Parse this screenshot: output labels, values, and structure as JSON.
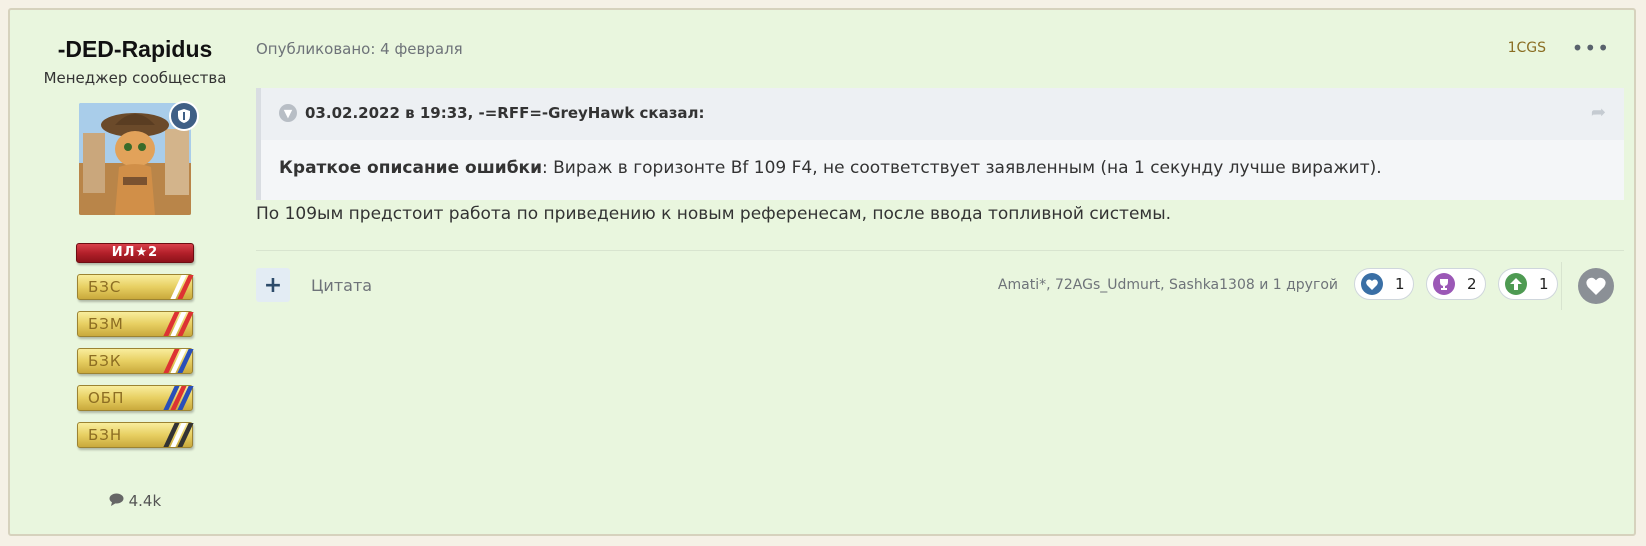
{
  "author": {
    "name": "-DED-Rapidus",
    "title": "Менеджер сообщества",
    "rank_badges": [
      "ИЛ★2",
      "БЗС",
      "БЗМ",
      "БЗК",
      "ОБП",
      "БЗН"
    ],
    "posts_count": "4.4k"
  },
  "post": {
    "published": "Опубликовано: 4 февраля",
    "clan": "1CGS",
    "more": "•••",
    "quote": {
      "header": "03.02.2022 в 19:33, -=RFF=-GreyHawk сказал:",
      "label": "Краткое описание ошибки",
      "text": ": Вираж в горизонте Bf 109 F4, не соответствует заявленным (на 1 секунду лучше виражит)."
    },
    "text": "По 109ым предстоит работа по приведению к новым референесам, после ввода топливной системы."
  },
  "footer": {
    "plus": "+",
    "quote_label": "Цитата",
    "likers": "Amati*, 72AGs_Udmurt, Sashka1308 и 1 другой",
    "reactions": [
      {
        "icon": "heart-icon",
        "count": "1",
        "color": "#3a6fa5"
      },
      {
        "icon": "trophy-icon",
        "count": "2",
        "color": "#9b58b6"
      },
      {
        "icon": "arrow-up-icon",
        "count": "1",
        "color": "#4e9a52"
      }
    ]
  }
}
